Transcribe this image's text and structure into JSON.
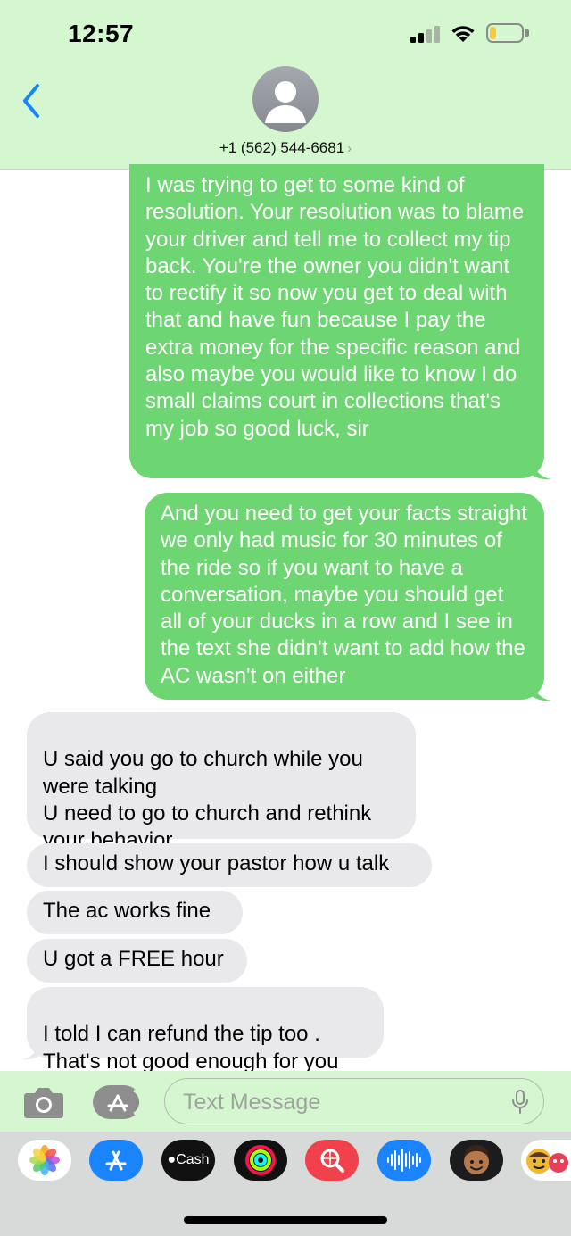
{
  "status_bar": {
    "time": "12:57",
    "battery_level": 0.22
  },
  "header": {
    "contact_name": "+1 (562) 544-6681",
    "chevron": "›"
  },
  "messages": [
    {
      "type": "sent",
      "text": "I was trying to get to some kind of resolution. Your resolution was to blame your driver and tell me to collect my tip back. You're the owner you didn't want to rectify it so now you get to deal with that and have fun because I pay the extra money for the specific reason and also maybe you would like to know I do small claims court in collections that's my job so good luck, sir"
    },
    {
      "type": "sent",
      "text": "And you need to get your facts straight we only had music for 30 minutes of the ride so if you want to have a conversation, maybe you should get all of your ducks in a row and I see in the text she didn't want to add how the AC wasn't on either"
    },
    {
      "type": "received",
      "text": "U said you go to church while you were talking\nU need to go to church and rethink your behavior"
    },
    {
      "type": "received",
      "text": "I should show your pastor how u talk"
    },
    {
      "type": "received",
      "text": "The ac works fine"
    },
    {
      "type": "received",
      "text": "U got a FREE hour"
    },
    {
      "type": "received",
      "text": "I told I can refund the tip too .\nThat's not good enough for you"
    }
  ],
  "compose": {
    "placeholder": "Text Message"
  },
  "app_drawer": {
    "apps": [
      {
        "name": "photos-icon"
      },
      {
        "name": "app-store-icon"
      },
      {
        "name": "apple-cash-icon",
        "label": "Cash"
      },
      {
        "name": "activity-icon"
      },
      {
        "name": "web-search-icon"
      },
      {
        "name": "audio-message-icon"
      },
      {
        "name": "memoji-icon"
      },
      {
        "name": "animoji-icon"
      }
    ]
  },
  "colors": {
    "header_bg": "#d4f7cf",
    "sent_bubble": "#6dd571",
    "received_bubble": "#e9e9eb",
    "accent": "#1a84ff"
  }
}
